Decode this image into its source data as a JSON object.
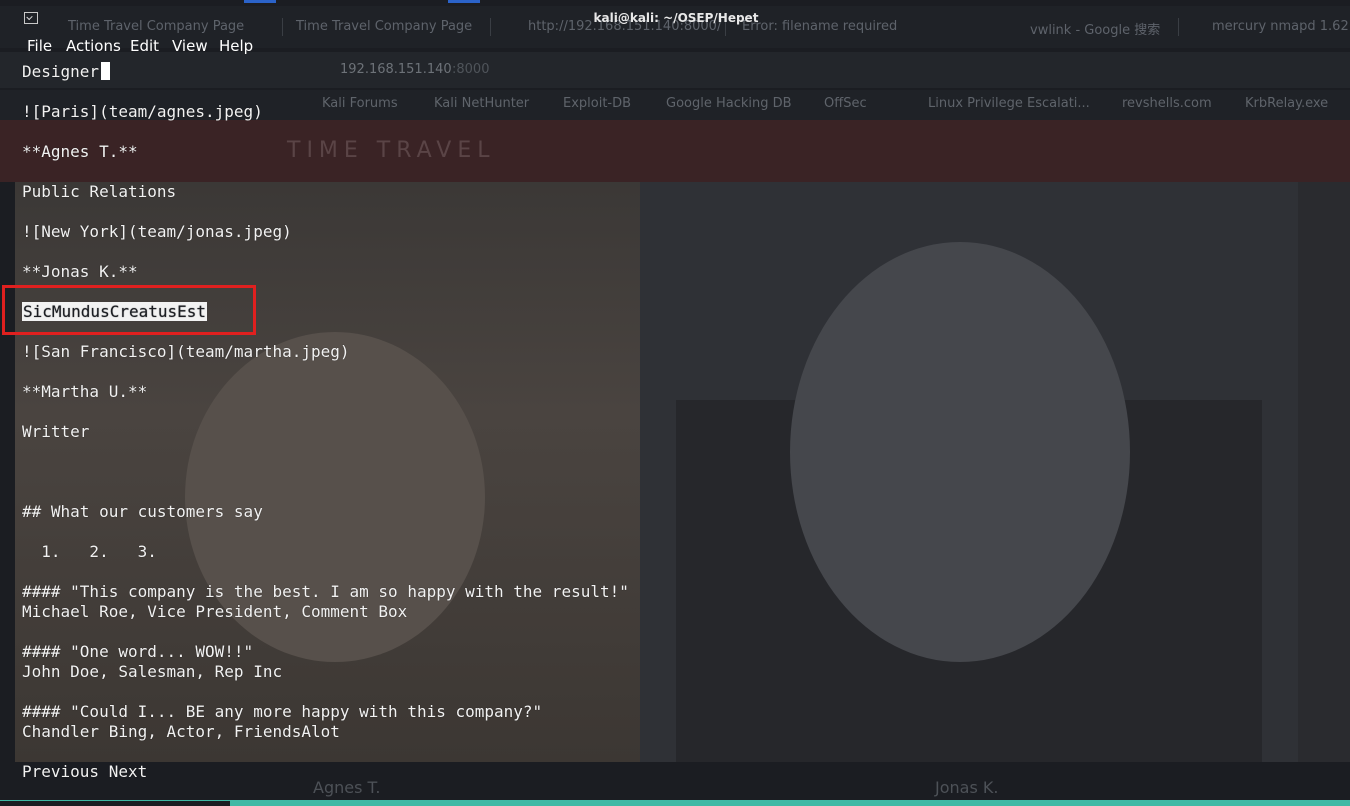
{
  "terminal": {
    "title": "kali@kali: ~/OSEP/Hepet",
    "menu": [
      "File",
      "Actions",
      "Edit",
      "View",
      "Help"
    ],
    "lines": [
      "Designer",
      "![Paris](team/agnes.jpeg)",
      "**Agnes T.**",
      "Public Relations",
      "![New York](team/jonas.jpeg)",
      "**Jonas K.**",
      "SicMundusCreatusEst",
      "![San Francisco](team/martha.jpeg)",
      "**Martha U.**",
      "Writter",
      "## What our customers say",
      "  1.   2.   3.",
      "#### \"This company is the best. I am so happy with the result!\"",
      "Michael Roe, Vice President, Comment Box",
      "#### \"One word... WOW!!\"",
      "John Doe, Salesman, Rep Inc",
      "#### \"Could I... BE any more happy with this company?\"",
      "Chandler Bing, Actor, FriendsAlot",
      "Previous Next"
    ]
  },
  "browser": {
    "tabs": [
      "Time Travel Company Page",
      "Time Travel Company Page",
      "http://192.168.151.140:8000/",
      "Error: filename required",
      "vwlink - Google 搜索",
      "mercury nmapd 1.62"
    ],
    "url": "192.168.151.140",
    "url_port": ":8000",
    "bookmarks": [
      "Kali Forums",
      "Kali NetHunter",
      "Exploit-DB",
      "Google Hacking DB",
      "OffSec",
      "Linux Privilege Escalati...",
      "revshells.com",
      "KrbRelay.exe"
    ],
    "hero_title": "TIME TRAVEL",
    "captions": [
      "Agnes T.",
      "Jonas K."
    ]
  },
  "colors": {
    "terminal_text": "#f2f2f2",
    "highlight_box": "#e0201f",
    "accent_strip": "#3fb9a5"
  }
}
